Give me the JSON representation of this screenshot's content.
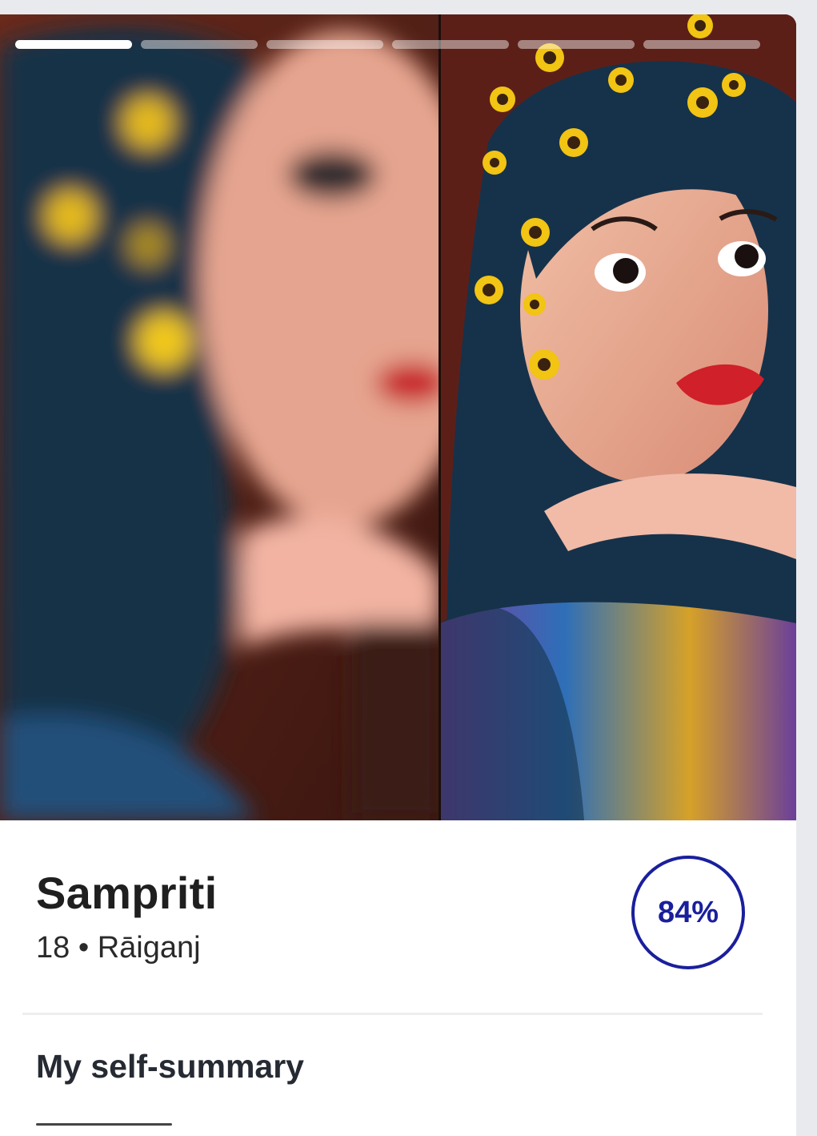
{
  "profile": {
    "name": "Sampriti",
    "age": "18",
    "separator": "•",
    "location": "Rāiganj",
    "match_percent": "84%"
  },
  "photos": {
    "count": 6,
    "active_index": 0
  },
  "sections": {
    "self_summary_title": "My self-summary"
  },
  "colors": {
    "accent": "#1a1f9c",
    "name_text": "#1f1f1f",
    "background": "#e9eaee"
  }
}
